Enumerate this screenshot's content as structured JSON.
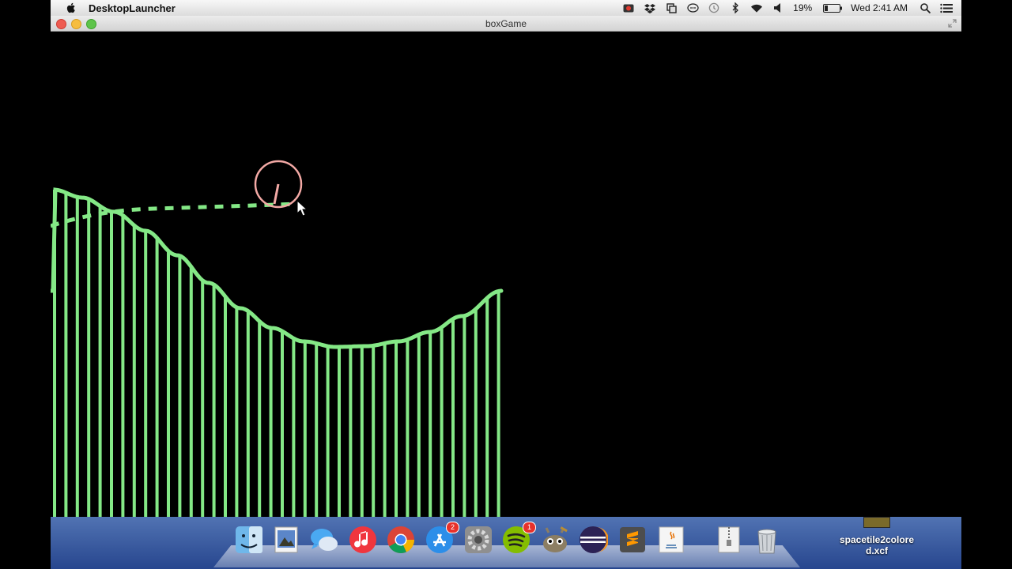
{
  "menubar": {
    "app_name": "DesktopLauncher",
    "battery": "19%",
    "clock": "Wed 2:41 AM"
  },
  "window": {
    "title": "boxGame"
  },
  "game": {
    "terrain_color": "#84e886",
    "ball_color": "#f3a9a5"
  },
  "dock": {
    "items": [
      {
        "name": "finder",
        "icon": "finder-icon"
      },
      {
        "name": "preview",
        "icon": "preview-icon"
      },
      {
        "name": "messages",
        "icon": "messages-icon"
      },
      {
        "name": "itunes",
        "icon": "itunes-icon"
      },
      {
        "name": "chrome",
        "icon": "chrome-icon"
      },
      {
        "name": "app-store",
        "icon": "app-store-icon",
        "badge": "2"
      },
      {
        "name": "system-preferences",
        "icon": "gear-icon"
      },
      {
        "name": "spotify",
        "icon": "spotify-icon",
        "badge": "1"
      },
      {
        "name": "gimp",
        "icon": "gimp-icon"
      },
      {
        "name": "eclipse",
        "icon": "eclipse-icon"
      },
      {
        "name": "sublime-text",
        "icon": "sublime-icon"
      },
      {
        "name": "java",
        "icon": "java-icon"
      },
      {
        "name": "archive",
        "icon": "zip-icon"
      },
      {
        "name": "trash",
        "icon": "trash-icon"
      }
    ],
    "app_store_badge": "2",
    "spotify_badge": "1",
    "desktop_file": "spacetile2colored.xcf",
    "desktop_file_line1": "spacetile2colore",
    "desktop_file_line2": "d.xcf"
  }
}
